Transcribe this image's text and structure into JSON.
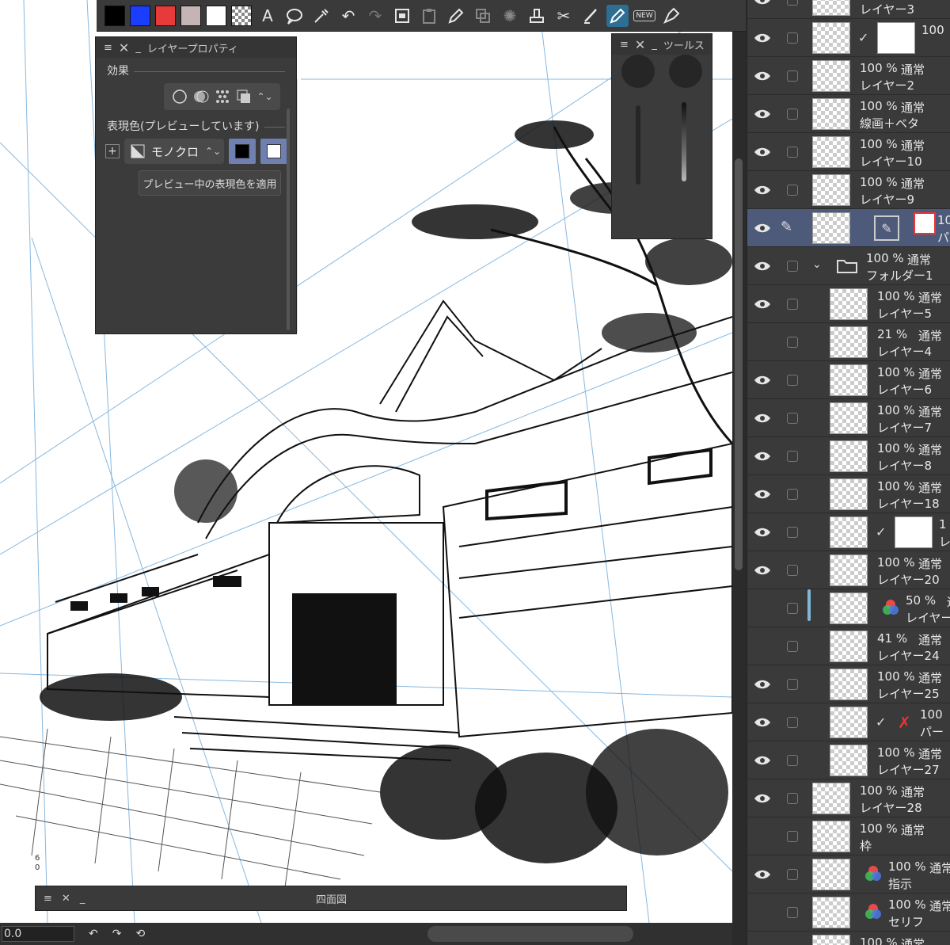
{
  "colors": {
    "canvas": "#ffffff",
    "panel": "#3b3b3b",
    "selected_layer": "#4e5a7a",
    "accent": "#2d6e93",
    "guide_line": "#6aa7d8"
  },
  "toolbar": {
    "swatches": [
      "#000000",
      "#1a3dff",
      "#e83a3a",
      "#c5b3b5",
      "#ffffff"
    ],
    "tools": [
      "transparent-swatch-icon",
      "text-icon",
      "balloon-icon",
      "eyedropper-icon",
      "undo-icon",
      "redo-icon",
      "scan-icon",
      "paste-icon",
      "pen-icon",
      "layer-icon",
      "loading-icon",
      "stamp-icon",
      "scissors-icon",
      "brush-icon",
      "vector-pen-icon",
      "new-badge-icon",
      "ink-pen-icon"
    ],
    "new_badge": "NEW"
  },
  "layer_property": {
    "title": "レイヤープロパティ",
    "effect_label": "効果",
    "expression_label": "表現色(プレビューしています)",
    "expression_value": "モノクロ",
    "apply_button": "プレビュー中の表現色を適用"
  },
  "tool_panel": {
    "title": "ツールス"
  },
  "bottom_panel": {
    "title": "四面図"
  },
  "status": {
    "zoom": "0.0",
    "ruler_a": "6",
    "ruler_b": "0"
  },
  "layers": [
    {
      "pct": "",
      "mode": "",
      "name": "レイヤー3",
      "eye": true,
      "kind": "plain",
      "partial": true
    },
    {
      "pct": "100",
      "mode": "",
      "name": "",
      "eye": true,
      "kind": "mask"
    },
    {
      "pct": "100 %",
      "mode": "通常",
      "name": "レイヤー2",
      "eye": true,
      "kind": "plain"
    },
    {
      "pct": "100 %",
      "mode": "通常",
      "name": "線画＋ベタ",
      "eye": true,
      "kind": "plain"
    },
    {
      "pct": "100 %",
      "mode": "通常",
      "name": "レイヤー10",
      "eye": true,
      "kind": "plain"
    },
    {
      "pct": "100 %",
      "mode": "通常",
      "name": "レイヤー9",
      "eye": true,
      "kind": "plain"
    },
    {
      "pct": "10",
      "mode": "",
      "name": "パー",
      "eye": true,
      "kind": "selected"
    },
    {
      "pct": "100 %",
      "mode": "通常",
      "name": "フォルダー1",
      "eye": true,
      "kind": "folder"
    },
    {
      "pct": "100 %",
      "mode": "通常",
      "name": "レイヤー5",
      "eye": true,
      "kind": "child"
    },
    {
      "pct": "21 %",
      "mode": "通常",
      "name": "レイヤー4",
      "eye": false,
      "kind": "child"
    },
    {
      "pct": "100 %",
      "mode": "通常",
      "name": "レイヤー6",
      "eye": true,
      "kind": "child"
    },
    {
      "pct": "100 %",
      "mode": "通常",
      "name": "レイヤー7",
      "eye": true,
      "kind": "child"
    },
    {
      "pct": "100 %",
      "mode": "通常",
      "name": "レイヤー8",
      "eye": true,
      "kind": "child"
    },
    {
      "pct": "100 %",
      "mode": "通常",
      "name": "レイヤー18",
      "eye": true,
      "kind": "child"
    },
    {
      "pct": "1",
      "mode": "",
      "name": "レ",
      "eye": true,
      "kind": "childmask"
    },
    {
      "pct": "100 %",
      "mode": "通常",
      "name": "レイヤー20",
      "eye": true,
      "kind": "child"
    },
    {
      "pct": "50 %",
      "mode": "通",
      "name": "レイヤー",
      "eye": false,
      "kind": "childrgb"
    },
    {
      "pct": "41 %",
      "mode": "通常",
      "name": "レイヤー24",
      "eye": false,
      "kind": "child"
    },
    {
      "pct": "100 %",
      "mode": "通常",
      "name": "レイヤー25",
      "eye": true,
      "kind": "child"
    },
    {
      "pct": "100",
      "mode": "",
      "name": "パー",
      "eye": true,
      "kind": "childred"
    },
    {
      "pct": "100 %",
      "mode": "通常",
      "name": "レイヤー27",
      "eye": true,
      "kind": "child"
    },
    {
      "pct": "100 %",
      "mode": "通常",
      "name": "レイヤー28",
      "eye": true,
      "kind": "plain"
    },
    {
      "pct": "100 %",
      "mode": "通常",
      "name": "枠",
      "eye": false,
      "kind": "plain"
    },
    {
      "pct": "100 %",
      "mode": "通常",
      "name": "指示",
      "eye": true,
      "kind": "rgb"
    },
    {
      "pct": "100 %",
      "mode": "通常",
      "name": "セリフ",
      "eye": false,
      "kind": "rgb"
    },
    {
      "pct": "100 %",
      "mode": "通常",
      "name": "",
      "eye": false,
      "kind": "plain",
      "partial": true
    }
  ]
}
